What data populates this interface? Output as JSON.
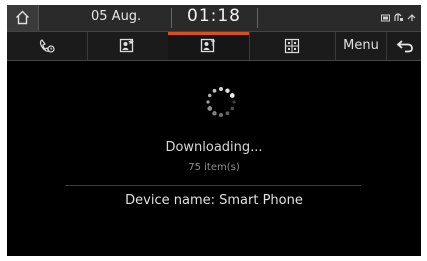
{
  "status_bar": {
    "date": "05 Aug.",
    "time": "01:18",
    "icons": [
      "battery-icon",
      "signal-icon",
      "bluetooth-icon"
    ]
  },
  "tabs": [
    {
      "icon": "phone-call-log-icon",
      "active": false
    },
    {
      "icon": "favorites-icon",
      "active": false
    },
    {
      "icon": "contacts-icon",
      "active": true
    },
    {
      "icon": "dial-pad-icon",
      "active": false
    }
  ],
  "header": {
    "menu_label": "Menu"
  },
  "content": {
    "status_text": "Downloading...",
    "item_count": "75 item(s)",
    "device_name": "Device name: Smart Phone"
  },
  "colors": {
    "accent": "#d9521b",
    "background": "#000000"
  }
}
